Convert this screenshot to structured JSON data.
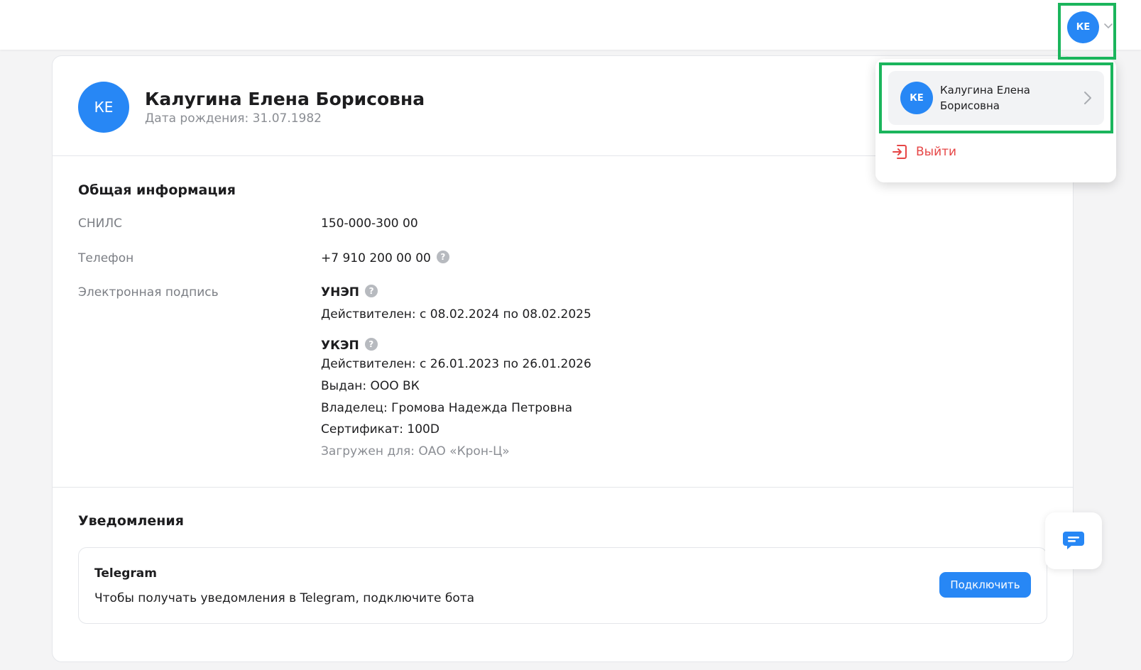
{
  "colors": {
    "accent": "#2787f5",
    "highlight": "#1bb55c",
    "danger": "#e64646"
  },
  "topbar": {
    "avatar_initials": "КЕ"
  },
  "dropdown": {
    "avatar_initials": "КЕ",
    "user_name": "Калугина Елена Борисовна",
    "logout_label": "Выйти",
    "logout_icon": "logout-icon"
  },
  "profile": {
    "avatar_initials": "КЕ",
    "full_name": "Калугина Елена Борисовна",
    "birth_label": "Дата рождения: 31.07.1982"
  },
  "general": {
    "title": "Общая информация",
    "snils_label": "СНИЛС",
    "snils_value": "150-000-300 00",
    "phone_label": "Телефон",
    "phone_value": "+7 910 200 00 00",
    "signature_label": "Электронная подпись",
    "unep": {
      "name": "УНЭП",
      "validity": "Действителен: с 08.02.2024 по 08.02.2025"
    },
    "ukep": {
      "name": "УКЭП",
      "validity": "Действителен: с 26.01.2023 по 26.01.2026",
      "issuer": "Выдан: ООО ВК",
      "owner": "Владелец: Громова Надежда Петровна",
      "certificate": "Сертификат: 100D",
      "uploaded_for": "Загружен для: ОАО «Крон-Ц»"
    }
  },
  "notifications": {
    "title": "Уведомления",
    "telegram": {
      "title": "Telegram",
      "description": "Чтобы получать уведомления в Telegram, подключите бота",
      "button": "Подключить"
    }
  },
  "chat": {
    "icon": "chat-icon"
  }
}
